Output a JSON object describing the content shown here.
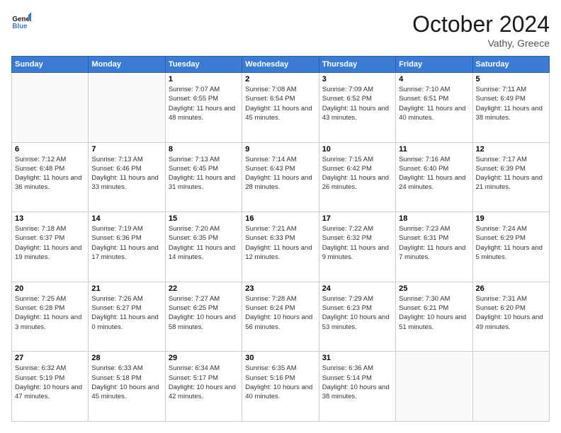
{
  "header": {
    "logo_line1": "General",
    "logo_line2": "Blue",
    "month": "October 2024",
    "location": "Vathy, Greece"
  },
  "weekdays": [
    "Sunday",
    "Monday",
    "Tuesday",
    "Wednesday",
    "Thursday",
    "Friday",
    "Saturday"
  ],
  "weeks": [
    [
      {
        "day": "",
        "empty": true
      },
      {
        "day": "",
        "empty": true
      },
      {
        "day": "1",
        "sunrise": "Sunrise: 7:07 AM",
        "sunset": "Sunset: 6:55 PM",
        "daylight": "Daylight: 11 hours and 48 minutes."
      },
      {
        "day": "2",
        "sunrise": "Sunrise: 7:08 AM",
        "sunset": "Sunset: 6:54 PM",
        "daylight": "Daylight: 11 hours and 45 minutes."
      },
      {
        "day": "3",
        "sunrise": "Sunrise: 7:09 AM",
        "sunset": "Sunset: 6:52 PM",
        "daylight": "Daylight: 11 hours and 43 minutes."
      },
      {
        "day": "4",
        "sunrise": "Sunrise: 7:10 AM",
        "sunset": "Sunset: 6:51 PM",
        "daylight": "Daylight: 11 hours and 40 minutes."
      },
      {
        "day": "5",
        "sunrise": "Sunrise: 7:11 AM",
        "sunset": "Sunset: 6:49 PM",
        "daylight": "Daylight: 11 hours and 38 minutes."
      }
    ],
    [
      {
        "day": "6",
        "sunrise": "Sunrise: 7:12 AM",
        "sunset": "Sunset: 6:48 PM",
        "daylight": "Daylight: 11 hours and 36 minutes."
      },
      {
        "day": "7",
        "sunrise": "Sunrise: 7:13 AM",
        "sunset": "Sunset: 6:46 PM",
        "daylight": "Daylight: 11 hours and 33 minutes."
      },
      {
        "day": "8",
        "sunrise": "Sunrise: 7:13 AM",
        "sunset": "Sunset: 6:45 PM",
        "daylight": "Daylight: 11 hours and 31 minutes."
      },
      {
        "day": "9",
        "sunrise": "Sunrise: 7:14 AM",
        "sunset": "Sunset: 6:43 PM",
        "daylight": "Daylight: 11 hours and 28 minutes."
      },
      {
        "day": "10",
        "sunrise": "Sunrise: 7:15 AM",
        "sunset": "Sunset: 6:42 PM",
        "daylight": "Daylight: 11 hours and 26 minutes."
      },
      {
        "day": "11",
        "sunrise": "Sunrise: 7:16 AM",
        "sunset": "Sunset: 6:40 PM",
        "daylight": "Daylight: 11 hours and 24 minutes."
      },
      {
        "day": "12",
        "sunrise": "Sunrise: 7:17 AM",
        "sunset": "Sunset: 6:39 PM",
        "daylight": "Daylight: 11 hours and 21 minutes."
      }
    ],
    [
      {
        "day": "13",
        "sunrise": "Sunrise: 7:18 AM",
        "sunset": "Sunset: 6:37 PM",
        "daylight": "Daylight: 11 hours and 19 minutes."
      },
      {
        "day": "14",
        "sunrise": "Sunrise: 7:19 AM",
        "sunset": "Sunset: 6:36 PM",
        "daylight": "Daylight: 11 hours and 17 minutes."
      },
      {
        "day": "15",
        "sunrise": "Sunrise: 7:20 AM",
        "sunset": "Sunset: 6:35 PM",
        "daylight": "Daylight: 11 hours and 14 minutes."
      },
      {
        "day": "16",
        "sunrise": "Sunrise: 7:21 AM",
        "sunset": "Sunset: 6:33 PM",
        "daylight": "Daylight: 11 hours and 12 minutes."
      },
      {
        "day": "17",
        "sunrise": "Sunrise: 7:22 AM",
        "sunset": "Sunset: 6:32 PM",
        "daylight": "Daylight: 11 hours and 9 minutes."
      },
      {
        "day": "18",
        "sunrise": "Sunrise: 7:23 AM",
        "sunset": "Sunset: 6:31 PM",
        "daylight": "Daylight: 11 hours and 7 minutes."
      },
      {
        "day": "19",
        "sunrise": "Sunrise: 7:24 AM",
        "sunset": "Sunset: 6:29 PM",
        "daylight": "Daylight: 11 hours and 5 minutes."
      }
    ],
    [
      {
        "day": "20",
        "sunrise": "Sunrise: 7:25 AM",
        "sunset": "Sunset: 6:28 PM",
        "daylight": "Daylight: 11 hours and 3 minutes."
      },
      {
        "day": "21",
        "sunrise": "Sunrise: 7:26 AM",
        "sunset": "Sunset: 6:27 PM",
        "daylight": "Daylight: 11 hours and 0 minutes."
      },
      {
        "day": "22",
        "sunrise": "Sunrise: 7:27 AM",
        "sunset": "Sunset: 6:25 PM",
        "daylight": "Daylight: 10 hours and 58 minutes."
      },
      {
        "day": "23",
        "sunrise": "Sunrise: 7:28 AM",
        "sunset": "Sunset: 6:24 PM",
        "daylight": "Daylight: 10 hours and 56 minutes."
      },
      {
        "day": "24",
        "sunrise": "Sunrise: 7:29 AM",
        "sunset": "Sunset: 6:23 PM",
        "daylight": "Daylight: 10 hours and 53 minutes."
      },
      {
        "day": "25",
        "sunrise": "Sunrise: 7:30 AM",
        "sunset": "Sunset: 6:21 PM",
        "daylight": "Daylight: 10 hours and 51 minutes."
      },
      {
        "day": "26",
        "sunrise": "Sunrise: 7:31 AM",
        "sunset": "Sunset: 6:20 PM",
        "daylight": "Daylight: 10 hours and 49 minutes."
      }
    ],
    [
      {
        "day": "27",
        "sunrise": "Sunrise: 6:32 AM",
        "sunset": "Sunset: 5:19 PM",
        "daylight": "Daylight: 10 hours and 47 minutes."
      },
      {
        "day": "28",
        "sunrise": "Sunrise: 6:33 AM",
        "sunset": "Sunset: 5:18 PM",
        "daylight": "Daylight: 10 hours and 45 minutes."
      },
      {
        "day": "29",
        "sunrise": "Sunrise: 6:34 AM",
        "sunset": "Sunset: 5:17 PM",
        "daylight": "Daylight: 10 hours and 42 minutes."
      },
      {
        "day": "30",
        "sunrise": "Sunrise: 6:35 AM",
        "sunset": "Sunset: 5:16 PM",
        "daylight": "Daylight: 10 hours and 40 minutes."
      },
      {
        "day": "31",
        "sunrise": "Sunrise: 6:36 AM",
        "sunset": "Sunset: 5:14 PM",
        "daylight": "Daylight: 10 hours and 38 minutes."
      },
      {
        "day": "",
        "empty": true
      },
      {
        "day": "",
        "empty": true
      }
    ]
  ]
}
